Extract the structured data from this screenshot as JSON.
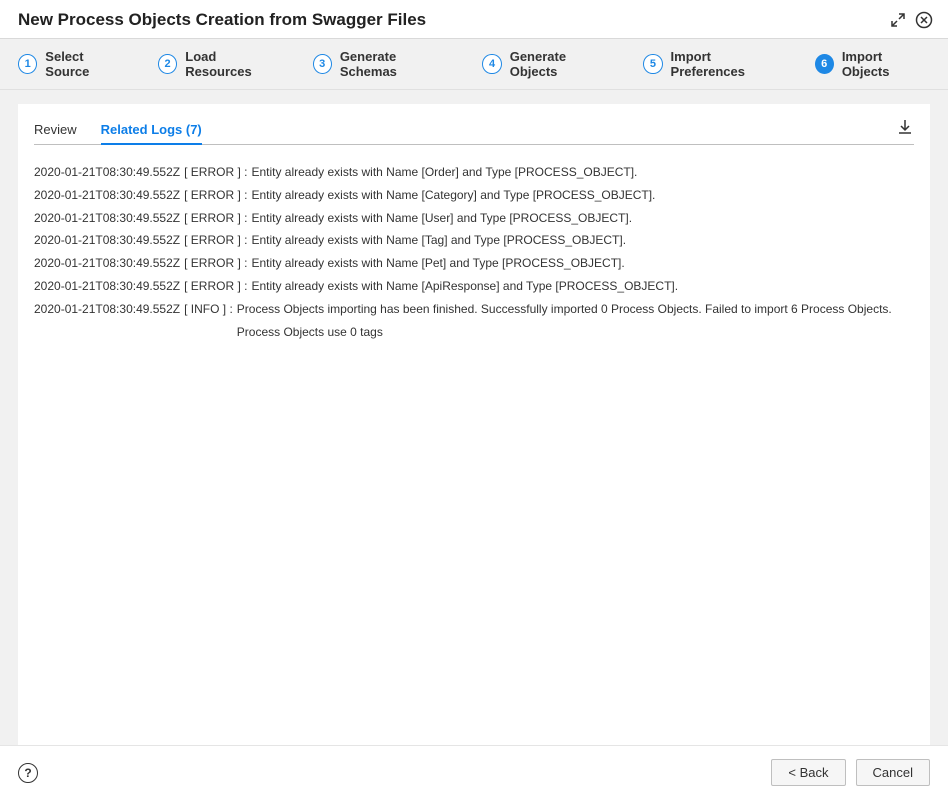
{
  "header": {
    "title": "New Process Objects Creation from Swagger Files"
  },
  "wizard": {
    "steps": [
      {
        "num": "1",
        "label": "Select Source"
      },
      {
        "num": "2",
        "label": "Load Resources"
      },
      {
        "num": "3",
        "label": "Generate Schemas"
      },
      {
        "num": "4",
        "label": "Generate Objects"
      },
      {
        "num": "5",
        "label": "Import Preferences"
      },
      {
        "num": "6",
        "label": "Import Objects"
      }
    ],
    "activeIndex": 5
  },
  "tabs": {
    "review": "Review",
    "logs": "Related Logs (7)",
    "activeIndex": 1
  },
  "logs": [
    {
      "ts": "2020-01-21T08:30:49.552Z",
      "level": "[ ERROR ] :",
      "msg": "Entity already exists with Name [Order] and Type [PROCESS_OBJECT]."
    },
    {
      "ts": "2020-01-21T08:30:49.552Z",
      "level": "[ ERROR ] :",
      "msg": "Entity already exists with Name [Category] and Type [PROCESS_OBJECT]."
    },
    {
      "ts": "2020-01-21T08:30:49.552Z",
      "level": "[ ERROR ] :",
      "msg": "Entity already exists with Name [User] and Type [PROCESS_OBJECT]."
    },
    {
      "ts": "2020-01-21T08:30:49.552Z",
      "level": "[ ERROR ] :",
      "msg": "Entity already exists with Name [Tag] and Type [PROCESS_OBJECT]."
    },
    {
      "ts": "2020-01-21T08:30:49.552Z",
      "level": "[ ERROR ] :",
      "msg": "Entity already exists with Name [Pet] and Type [PROCESS_OBJECT]."
    },
    {
      "ts": "2020-01-21T08:30:49.552Z",
      "level": "[ ERROR ] :",
      "msg": "Entity already exists with Name [ApiResponse] and Type [PROCESS_OBJECT]."
    },
    {
      "ts": "2020-01-21T08:30:49.552Z",
      "level": "[ INFO ] :",
      "msg": "Process Objects importing has been finished. Successfully imported 0 Process Objects. Failed to import 6 Process Objects. Process Objects use 0 tags"
    }
  ],
  "footer": {
    "back": "< Back",
    "cancel": "Cancel"
  }
}
